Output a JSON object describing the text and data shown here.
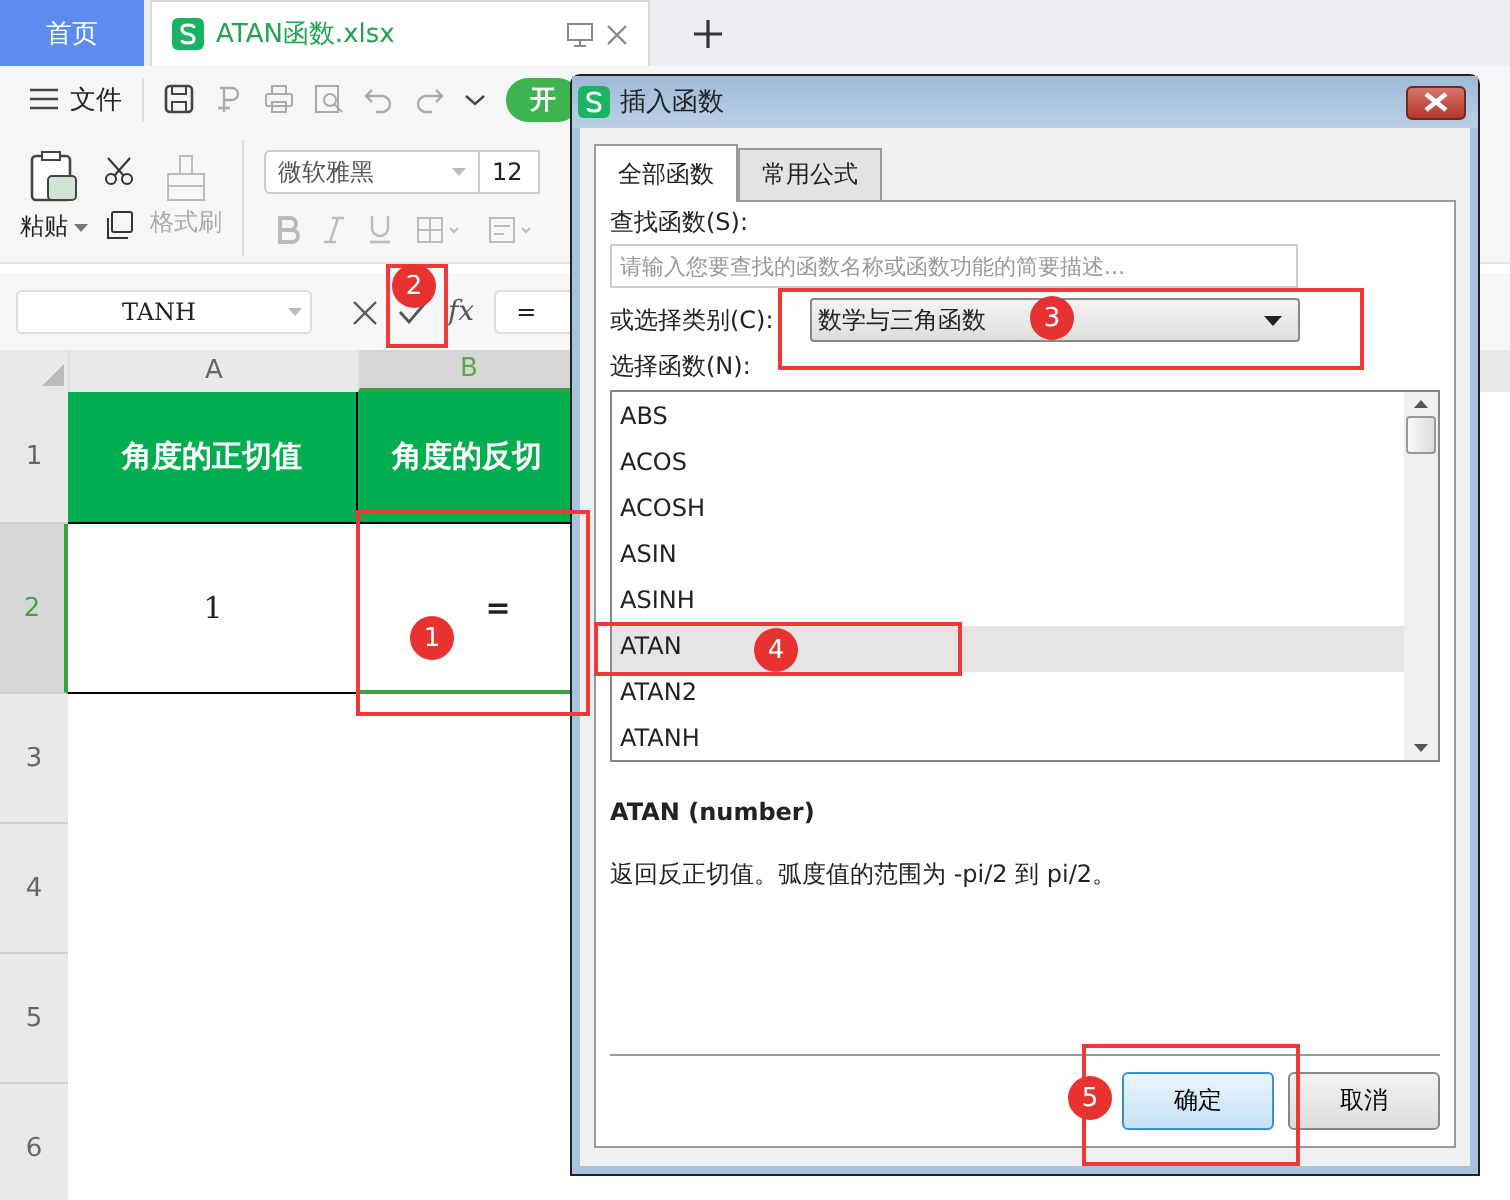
{
  "tabs": [
    {
      "label": "首页",
      "selected": false,
      "kind": "home"
    },
    {
      "label": "ATAN函数.xlsx",
      "selected": true,
      "kind": "file"
    }
  ],
  "toolbar": {
    "file_menu": "文件",
    "start_tab": "开"
  },
  "ribbon": {
    "paste": "粘贴",
    "format_painter": "格式刷",
    "font": "微软雅黑",
    "font_size": "12"
  },
  "formula_bar": {
    "name_box": "TANH",
    "function_label": "fx",
    "formula": "="
  },
  "sheet": {
    "columns": [
      "A",
      "B"
    ],
    "rows": [
      {
        "number": "1",
        "selected": false,
        "cells": [
          "角度的正切值",
          "角度的反切"
        ]
      },
      {
        "number": "2",
        "selected": true,
        "cells": [
          "1",
          "="
        ]
      },
      {
        "number": "3",
        "selected": false,
        "cells": [
          "",
          ""
        ]
      },
      {
        "number": "4",
        "selected": false,
        "cells": [
          "",
          ""
        ]
      },
      {
        "number": "5",
        "selected": false,
        "cells": [
          "",
          ""
        ]
      },
      {
        "number": "6",
        "selected": false,
        "cells": [
          "",
          ""
        ]
      }
    ]
  },
  "dialog": {
    "title": "插入函数",
    "tabs": [
      {
        "label": "全部函数",
        "selected": true
      },
      {
        "label": "常用公式",
        "selected": false
      }
    ],
    "search_label": "查找函数(S):",
    "search_placeholder": "请输入您要查找的函数名称或函数功能的简要描述...",
    "category_label": "或选择类别(C):",
    "category": "数学与三角函数",
    "function_label": "选择函数(N):",
    "functions": [
      {
        "name": "ABS",
        "selected": false
      },
      {
        "name": "ACOS",
        "selected": false
      },
      {
        "name": "ACOSH",
        "selected": false
      },
      {
        "name": "ASIN",
        "selected": false
      },
      {
        "name": "ASINH",
        "selected": false
      },
      {
        "name": "ATAN",
        "selected": true
      },
      {
        "name": "ATAN2",
        "selected": false
      },
      {
        "name": "ATANH",
        "selected": false
      }
    ],
    "signature": "ATAN (number)",
    "description": "返回反正切值。弧度值的范围为 -pi/2 到 pi/2。",
    "buttons": [
      {
        "label": "确定",
        "kind": "default"
      },
      {
        "label": "取消",
        "kind": "normal"
      }
    ]
  },
  "annotations": [
    {
      "label": "1"
    },
    {
      "label": "2"
    },
    {
      "label": "3"
    },
    {
      "label": "4"
    },
    {
      "label": "5"
    }
  ]
}
